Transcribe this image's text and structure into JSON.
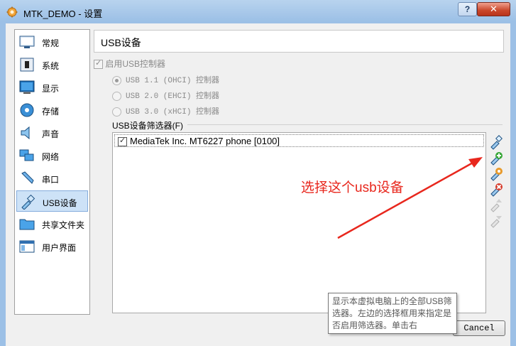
{
  "window": {
    "title": "MTK_DEMO - 设置",
    "help_label": "?",
    "close_label": "✕"
  },
  "sidebar": {
    "items": [
      {
        "label": "常规",
        "icon": "general-icon"
      },
      {
        "label": "系统",
        "icon": "system-chip-icon"
      },
      {
        "label": "显示",
        "icon": "display-monitor-icon"
      },
      {
        "label": "存储",
        "icon": "storage-disk-icon"
      },
      {
        "label": "声音",
        "icon": "audio-speaker-icon"
      },
      {
        "label": "网络",
        "icon": "network-icon"
      },
      {
        "label": "串口",
        "icon": "serial-port-icon"
      },
      {
        "label": "USB设备",
        "icon": "usb-icon",
        "selected": true
      },
      {
        "label": "共享文件夹",
        "icon": "shared-folder-icon"
      },
      {
        "label": "用户界面",
        "icon": "user-interface-icon"
      }
    ]
  },
  "page": {
    "title": "USB设备",
    "enable_usb_label": "启用USB控制器",
    "usb_options": [
      {
        "label": "USB 1.1 (OHCI) 控制器",
        "selected": true
      },
      {
        "label": "USB 2.0 (EHCI) 控制器",
        "selected": false
      },
      {
        "label": "USB 3.0 (xHCI) 控制器",
        "selected": false
      }
    ],
    "filters_label": "USB设备筛选器(F)",
    "filters": [
      {
        "label": "MediaTek Inc. MT6227 phone [0100]",
        "checked": true
      }
    ],
    "tools": [
      "add-empty-filter-icon",
      "add-filter-from-device-icon",
      "edit-filter-icon",
      "remove-filter-icon",
      "move-filter-up-icon",
      "move-filter-down-icon"
    ]
  },
  "annotation": "选择这个usb设备",
  "buttons": {
    "cancel": "Cancel"
  },
  "tooltip": "显示本虚拟电脑上的全部USB筛选器。左边的选择框用来指定是否启用筛选器。单击右",
  "colors": {
    "annotation": "#e8271d",
    "selection": "#cde2f7",
    "title_bar": "#9cc0e6"
  }
}
